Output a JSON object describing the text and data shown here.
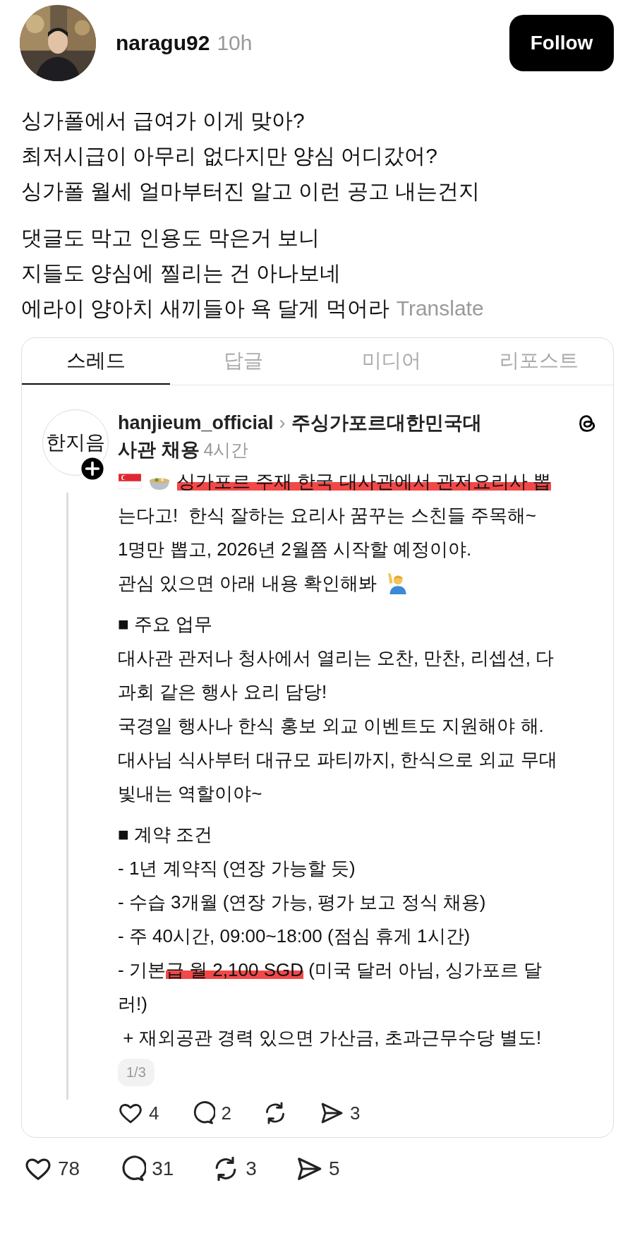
{
  "post": {
    "username": "naragu92",
    "time": "10h",
    "follow_label": "Follow",
    "paragraphs": [
      [
        "싱가폴에서 급여가 이게 맞아?",
        "최저시급이 아무리 없다지만 양심 어디갔어?",
        "싱가폴 월세 얼마부터진 알고 이런 공고 내는건지"
      ],
      [
        "댓글도 막고 인용도 막은거 보니",
        "지들도 양심에 찔리는 건 아나보네",
        "에라이 양아치 새끼들아 욕 달게 먹어라"
      ]
    ],
    "translate": "Translate"
  },
  "tabs": [
    {
      "label": "스레드",
      "selected": true
    },
    {
      "label": "답글",
      "selected": false
    },
    {
      "label": "미디어",
      "selected": false
    },
    {
      "label": "리포스트",
      "selected": false
    }
  ],
  "quoted": {
    "logo_text": "한지음",
    "username": "hanjieum_official",
    "topic_sep": "›",
    "topic_line1": "주싱가포르대한민국대",
    "topic_line2": "사관 채용",
    "time": "4시간",
    "paragraphs": [
      [
        [
          {
            "text": "싱가포르 주재 한국 대사관에서 관저요리사 뽑",
            "scribbled": true
          }
        ],
        [
          {
            "text": "는다고!  한식 잘하는 요리사 꿈꾸는 스친들 주목해~",
            "scribbled": false
          }
        ],
        [
          {
            "text": "1명만 뽑고, 2026년 2월쯤 시작할 예정이야.",
            "scribbled": false
          }
        ],
        [
          {
            "text": "관심 있으면 아래 내용 확인해봐",
            "scribbled": false
          }
        ]
      ],
      [
        [
          {
            "text": "■ 주요 업무",
            "scribbled": false
          }
        ],
        [
          {
            "text": "대사관 관저나 청사에서 열리는 오찬, 만찬, 리셉션, 다",
            "scribbled": false
          }
        ],
        [
          {
            "text": "과회 같은 행사 요리 담당!",
            "scribbled": false
          }
        ],
        [
          {
            "text": "국경일 행사나 한식 홍보 외교 이벤트도 지원해야 해.",
            "scribbled": false
          }
        ],
        [
          {
            "text": "대사님 식사부터 대규모 파티까지, 한식으로 외교 무대",
            "scribbled": false
          }
        ],
        [
          {
            "text": "빛내는 역할이야~",
            "scribbled": false
          }
        ]
      ],
      [
        [
          {
            "text": "■ 계약 조건",
            "scribbled": false
          }
        ],
        [
          {
            "text": "- 1년 계약직 (연장 가능할 듯)",
            "scribbled": false
          }
        ],
        [
          {
            "text": "- 수습 3개월 (연장 가능, 평가 보고 정식 채용)",
            "scribbled": false
          }
        ],
        [
          {
            "text": "- 주 40시간, 09:00~18:00 (점심 휴게 1시간)",
            "scribbled": false
          }
        ],
        [
          {
            "text": "- 기본",
            "scribbled": false
          },
          {
            "text": "급 월 2,100 SGD",
            "scribbled": true
          },
          {
            "text": " (미국 달러 아님, 싱가포르 달",
            "scribbled": false
          }
        ],
        [
          {
            "text": "러!)",
            "scribbled": false
          }
        ],
        [
          {
            "text": " + 재외공관 경력 있으면 가산금, 초과근무수당 별도!",
            "scribbled": false
          }
        ]
      ]
    ],
    "page_badge": "1/3",
    "actions": [
      {
        "kind": "like",
        "count": "4"
      },
      {
        "kind": "reply",
        "count": "2"
      },
      {
        "kind": "repost"
      },
      {
        "kind": "share",
        "count": "3"
      }
    ]
  },
  "actions": [
    {
      "kind": "like",
      "count": "78"
    },
    {
      "kind": "reply",
      "count": "31"
    },
    {
      "kind": "repost",
      "count": "3"
    },
    {
      "kind": "share",
      "count": "5"
    }
  ]
}
